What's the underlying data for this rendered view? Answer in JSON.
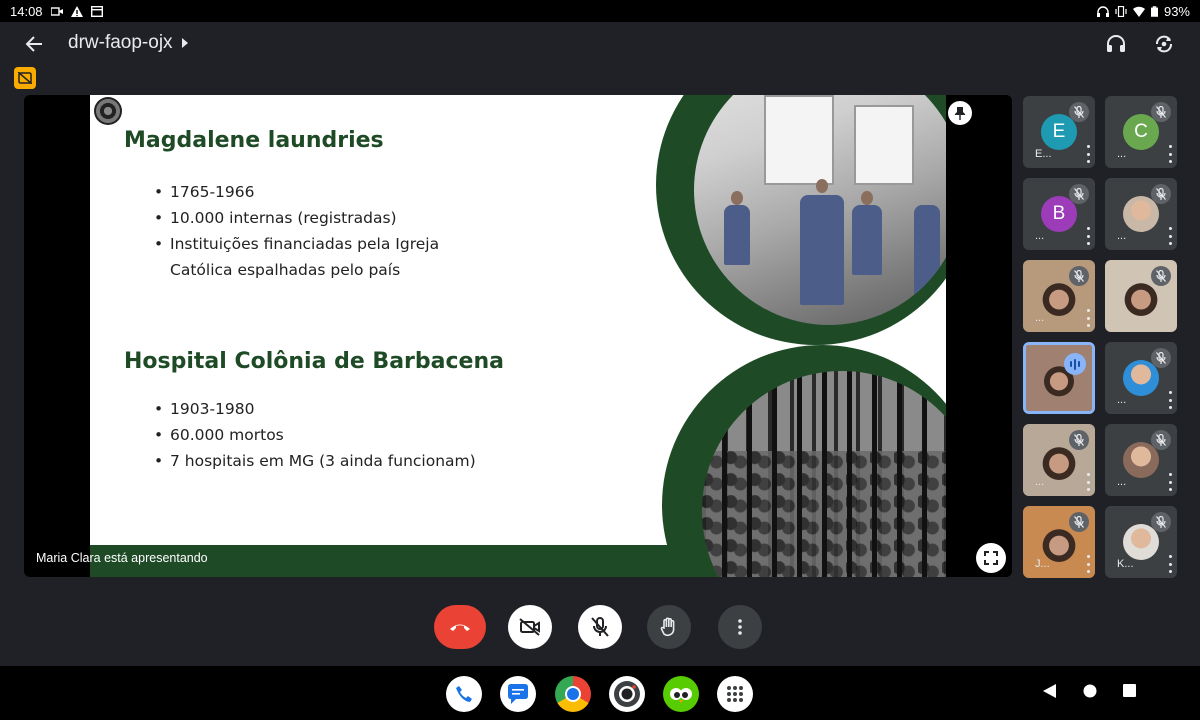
{
  "status_bar": {
    "time": "14:08",
    "battery": "93%"
  },
  "header": {
    "meeting_code": "drw-faop-ojx"
  },
  "presentation": {
    "presenter_label": "Maria Clara está apresentando",
    "slide": {
      "heading1": "Magdalene laundries",
      "list1": [
        "1765-1966",
        "10.000 internas (registradas)",
        "Instituições financiadas pela Igreja",
        "Católica espalhadas pelo país"
      ],
      "heading2": "Hospital Colônia de Barbacena",
      "list2": [
        "1903-1980",
        "60.000 mortos",
        "7 hospitais em MG (3 ainda funcionam)"
      ]
    }
  },
  "participants": [
    {
      "initial": "E",
      "name": "E...",
      "color": "#1e9bb3",
      "muted": true
    },
    {
      "initial": "C",
      "name": "...",
      "color": "#6aa84f",
      "muted": true
    },
    {
      "initial": "B",
      "name": "...",
      "color": "#9c3cb8",
      "muted": true
    },
    {
      "initial": "",
      "name": "...",
      "color": "#c9b8a8",
      "muted": true
    },
    {
      "initial": "",
      "name": "...",
      "color": "#b79a7c",
      "muted": true
    },
    {
      "initial": "",
      "name": "",
      "color": "#d0c4b4",
      "muted": true
    },
    {
      "initial": "",
      "name": "",
      "color": "#a08070",
      "muted": false
    },
    {
      "initial": "",
      "name": "...",
      "color": "#2e8fd8",
      "muted": true
    },
    {
      "initial": "",
      "name": "...",
      "color": "#b8a898",
      "muted": true
    },
    {
      "initial": "",
      "name": "...",
      "color": "#8a6a5a",
      "muted": true
    },
    {
      "initial": "",
      "name": "J...",
      "color": "#c88a50",
      "muted": true
    },
    {
      "initial": "",
      "name": "K...",
      "color": "#e0dcd8",
      "muted": true
    }
  ],
  "colors": {
    "end_call": "#ea4335",
    "slide_green": "#1e4a26",
    "accent_blue": "#8ab4f8"
  },
  "icons": {
    "back": "arrow-left-icon",
    "audio": "headphones-icon",
    "switch_camera": "camera-switch-icon",
    "pin": "pin-icon",
    "fullscreen": "fullscreen-icon",
    "end_call": "phone-hangup-icon",
    "camera_off": "video-off-icon",
    "mic_off": "mic-off-icon",
    "raise_hand": "hand-icon",
    "more": "more-vertical-icon"
  },
  "dock_apps": [
    "phone",
    "messages",
    "chrome",
    "camera",
    "duolingo",
    "app-drawer"
  ]
}
